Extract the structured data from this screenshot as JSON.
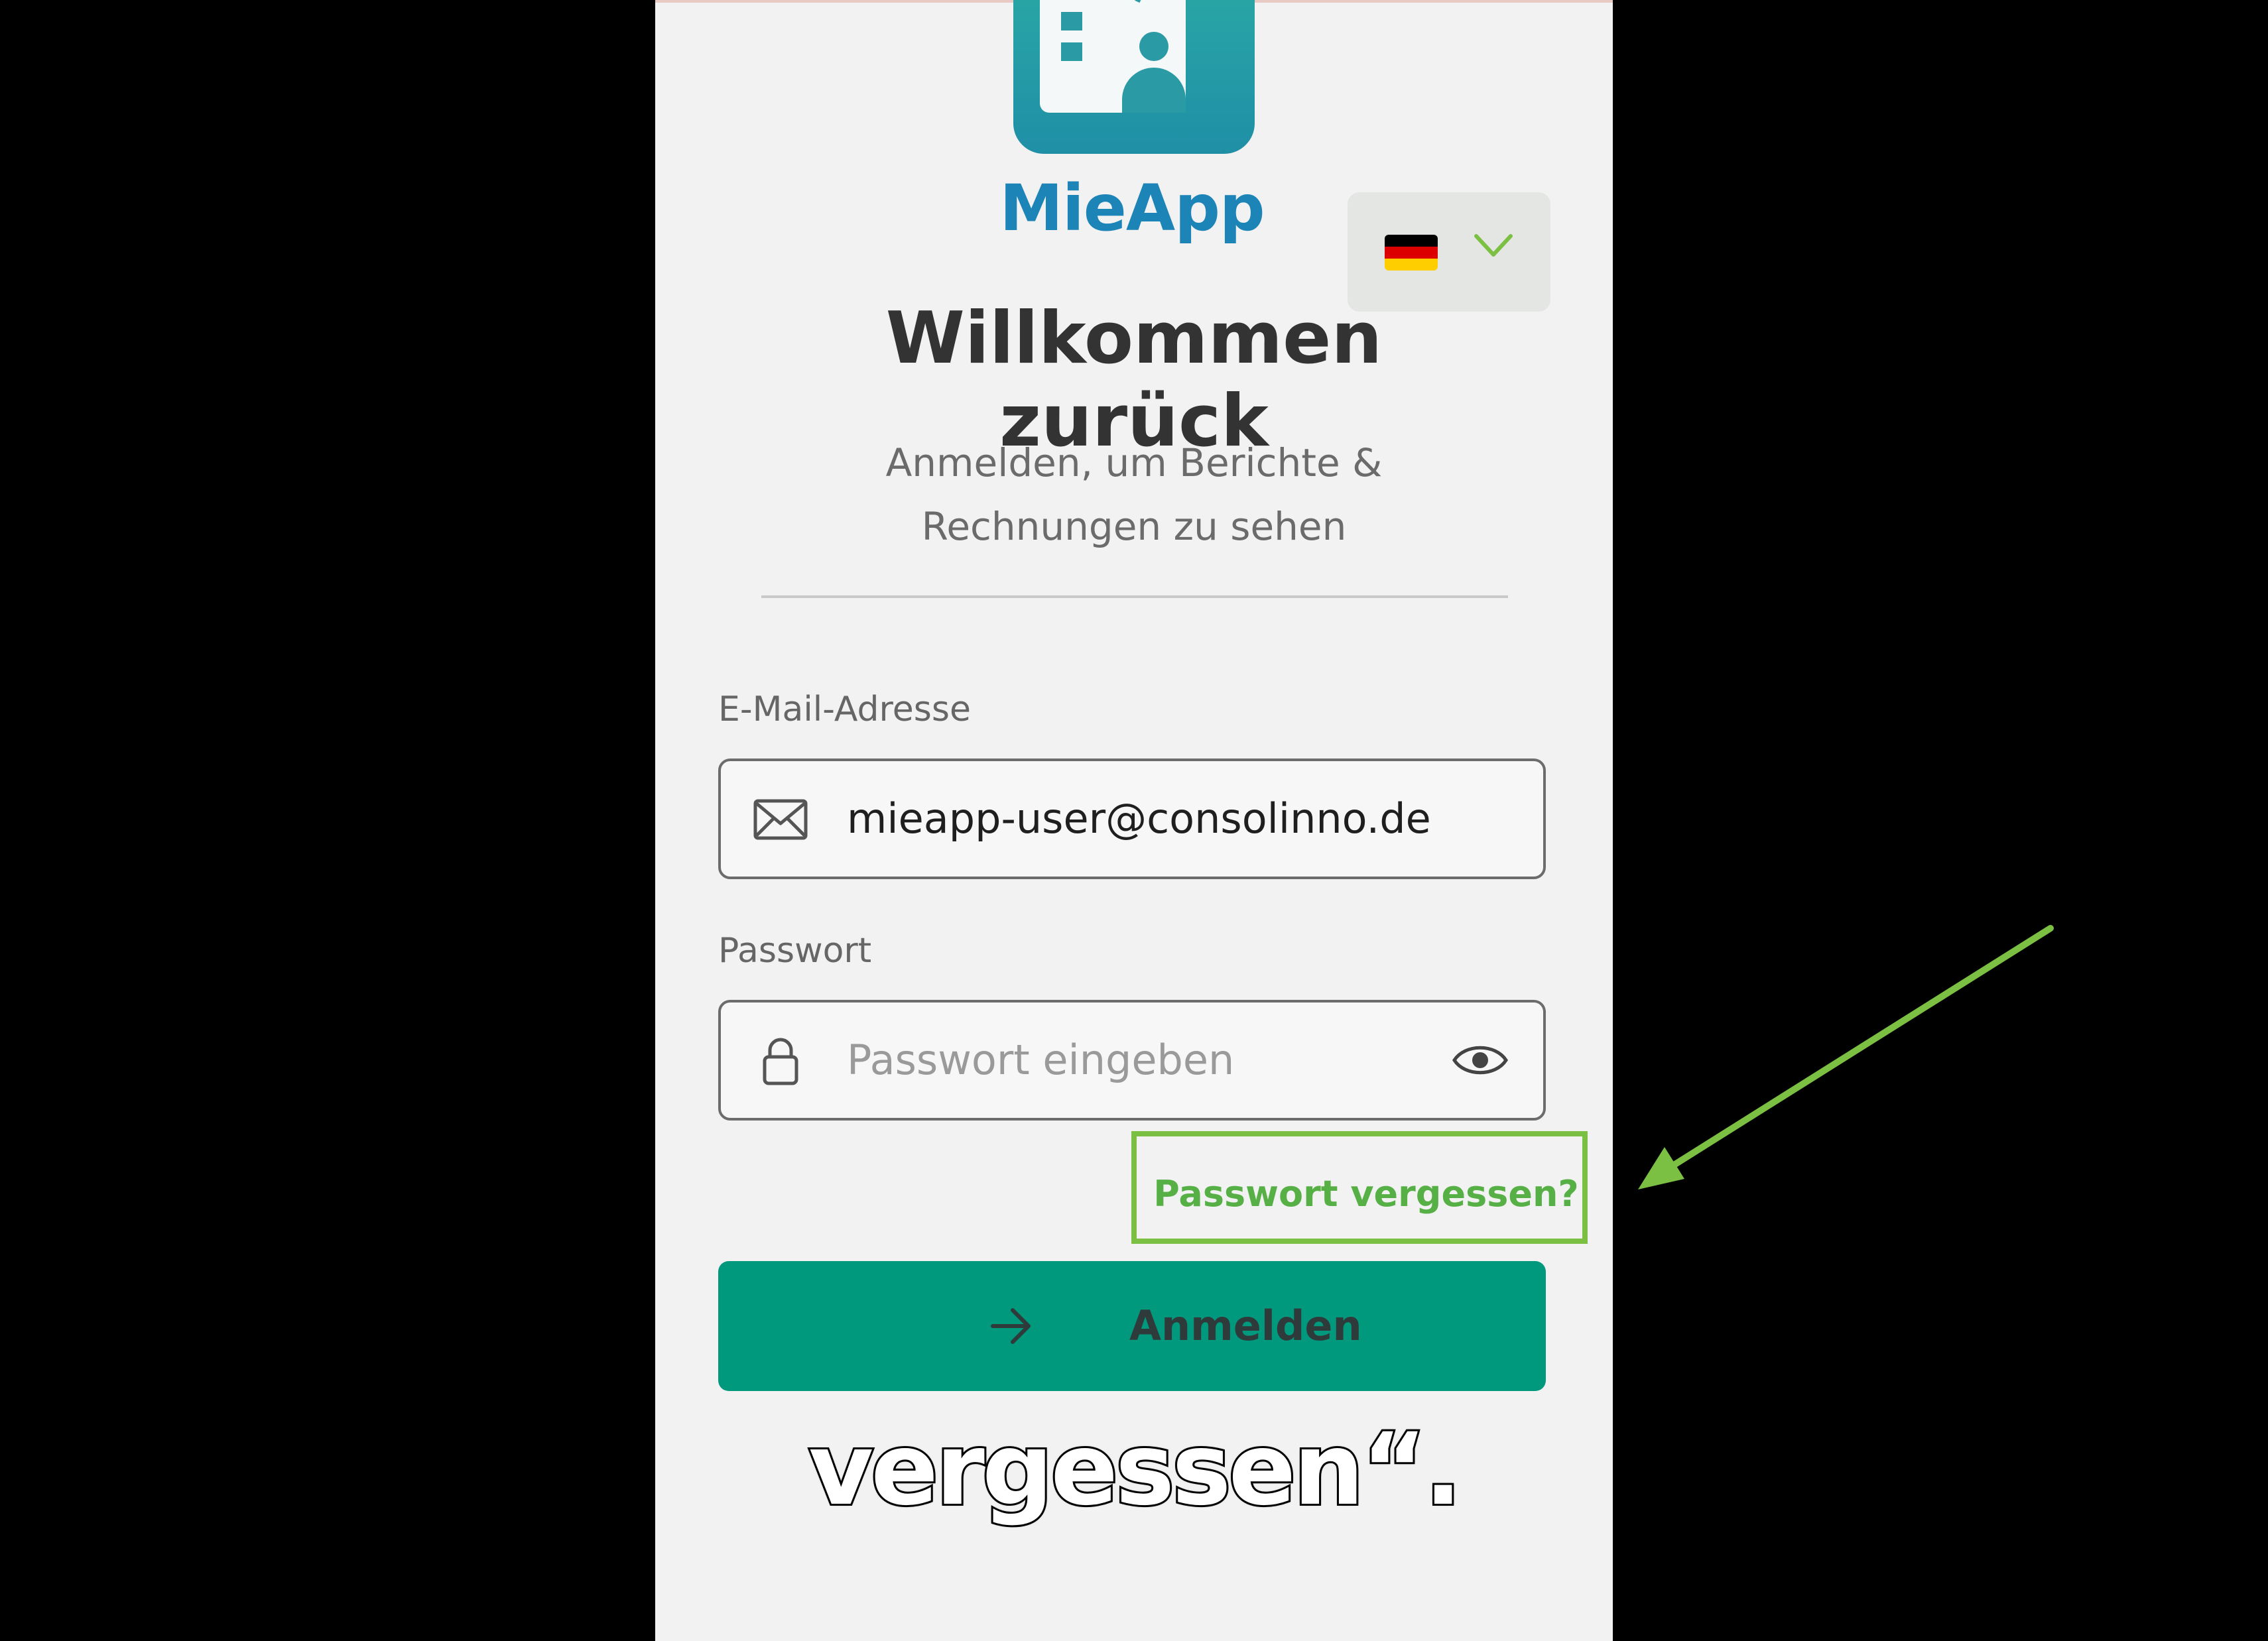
{
  "app": {
    "name": "MieApp"
  },
  "language": {
    "selected": "German",
    "flag_colors": [
      "#000000",
      "#dd0000",
      "#ffce00"
    ]
  },
  "header": {
    "title": "Willkommen zurück",
    "subtitle": "Anmelden, um Berichte & Rechnungen zu sehen"
  },
  "form": {
    "email_label": "E-Mail-Adresse",
    "email_value": "mieapp-user@consolinno.de",
    "password_label": "Passwort",
    "password_placeholder": "Passwort eingeben",
    "forgot_password": "Passwort vergessen?",
    "submit_label": "Anmelden"
  },
  "caption": {
    "text": "vergessen“."
  },
  "colors": {
    "brand_blue": "#1d84b8",
    "primary_button": "#00997e",
    "highlight_green": "#7bc043"
  }
}
